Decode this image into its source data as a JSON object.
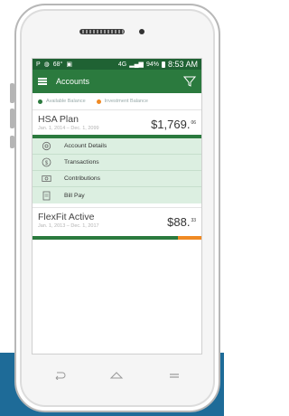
{
  "colors": {
    "brand_green": "#2b7a3e",
    "status_green": "#1f6233",
    "menu_bg": "#dcefe1",
    "investment_orange": "#f08a24",
    "page_band_blue": "#1e6b98"
  },
  "status_bar": {
    "left_icons": [
      "parking-icon",
      "location-icon",
      "weather-icon",
      "image-icon"
    ],
    "temperature": "68°",
    "signal_text": "4G",
    "battery": "94%",
    "time": "8:53 AM"
  },
  "app_bar": {
    "title": "Accounts",
    "menu_icon": "hamburger-icon",
    "filter_icon": "filter-icon"
  },
  "legend": {
    "available": "Available Balance",
    "investment": "Investment Balance"
  },
  "accounts": [
    {
      "name": "HSA Plan",
      "dates": "Jan. 1, 2014 – Dec. 1, 2099",
      "amount": "$1,769.",
      "cents": "06",
      "available_fraction": 1.0
    },
    {
      "name": "FlexFit Active",
      "dates": "Jan. 1, 2013 – Dec. 1, 2017",
      "amount": "$88.",
      "cents": "33",
      "available_fraction": 0.86
    }
  ],
  "menu": [
    {
      "label": "Account Details",
      "icon": "settings-icon"
    },
    {
      "label": "Transactions",
      "icon": "dollar-circle-icon"
    },
    {
      "label": "Contributions",
      "icon": "cash-icon"
    },
    {
      "label": "Bill Pay",
      "icon": "bill-icon"
    }
  ],
  "navbar": {
    "back": "back-icon",
    "home": "home-icon",
    "recent": "recent-apps-icon"
  }
}
